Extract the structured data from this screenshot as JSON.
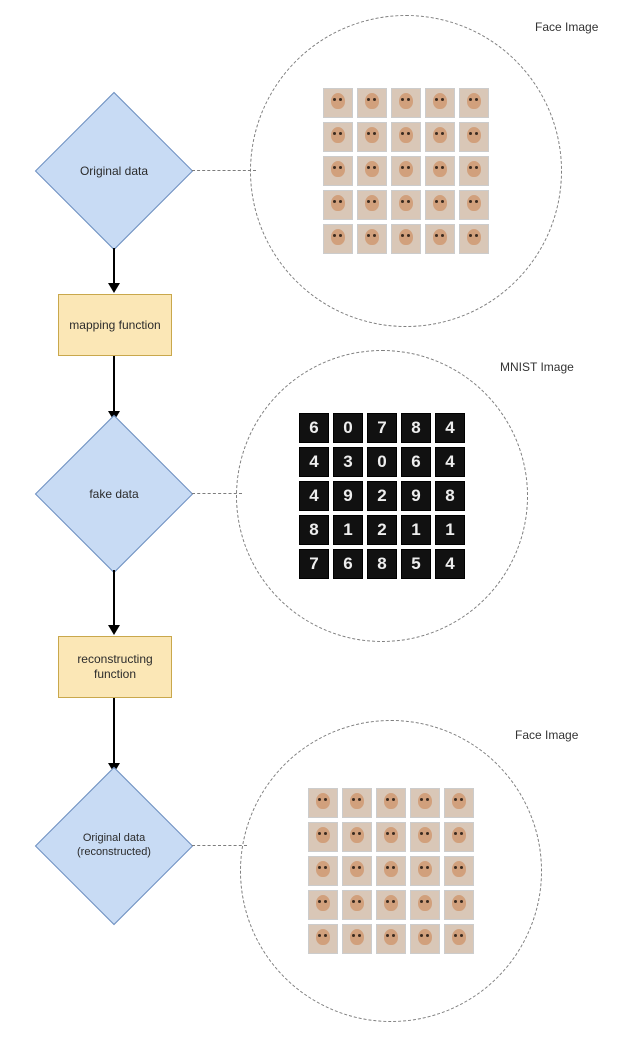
{
  "flow": {
    "node_original": "Original data",
    "node_mapping": "mapping function",
    "node_fake": "fake data",
    "node_reconstruct": "reconstructing function",
    "node_reconstructed": "Original data (reconstructed)"
  },
  "callouts": {
    "top_title": "Face Image",
    "mid_title": "MNIST Image",
    "bot_title": "Face Image"
  },
  "grids": {
    "cols": 5,
    "rows": 5,
    "face_count": 25,
    "mnist_digits": [
      "6",
      "0",
      "7",
      "8",
      "4",
      "4",
      "3",
      "0",
      "6",
      "4",
      "4",
      "9",
      "2",
      "9",
      "8",
      "8",
      "1",
      "2",
      "1",
      "1",
      "7",
      "6",
      "8",
      "5",
      "4"
    ]
  }
}
